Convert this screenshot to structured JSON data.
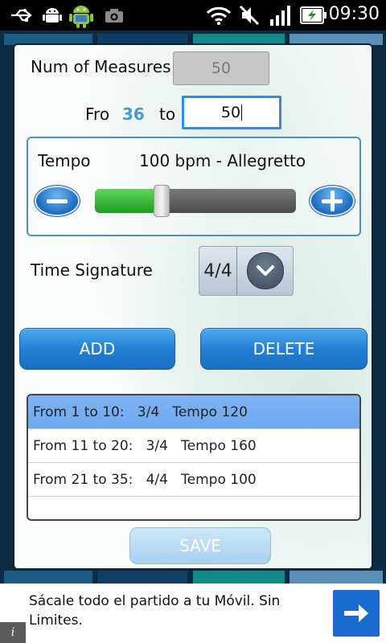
{
  "status_bar": {
    "time": "09:30",
    "icons": [
      "usb-icon",
      "android-debug-icon",
      "android-app-icon",
      "camera-icon",
      "wifi-icon",
      "mute-icon",
      "signal-icon",
      "battery-charging-icon"
    ]
  },
  "dialog": {
    "measures": {
      "label": "Num of Measures",
      "value": "50"
    },
    "range": {
      "from_label": "Fro",
      "from_value": "36",
      "to_label": "to",
      "to_value": "50"
    },
    "tempo": {
      "label": "Tempo",
      "value_text": "100 bpm - Allegretto",
      "slider_fraction": 0.33
    },
    "time_signature": {
      "label": "Time Signature",
      "value": "4/4"
    },
    "buttons": {
      "add": "ADD",
      "delete": "DELETE",
      "save": "SAVE"
    },
    "rows": [
      {
        "text": "From 1 to 10:   3/4   Tempo 120",
        "selected": true
      },
      {
        "text": "From 11 to 20:   3/4   Tempo 160",
        "selected": false
      },
      {
        "text": "From 21 to 35:   4/4   Tempo 100",
        "selected": false
      },
      {
        "text": "",
        "selected": false
      }
    ]
  },
  "ad": {
    "text": "Sácale todo el partido a tu Móvil. Sin Limites.",
    "info": "i"
  },
  "colors": {
    "accent": "#2280d6",
    "slider_green": "#2fb52c",
    "selected_row": "#6da8f0",
    "from_value": "#4a9ad0"
  }
}
